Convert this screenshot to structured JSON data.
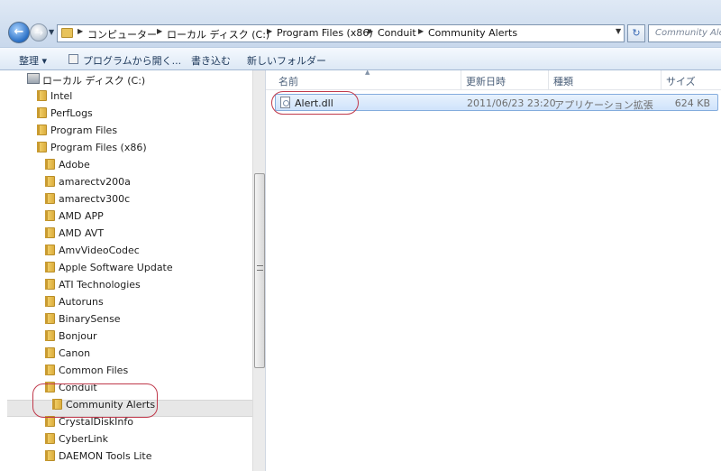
{
  "address_bar": {
    "crumbs": [
      "コンピューター",
      "ローカル ディスク (C:)",
      "Program Files (x86)",
      "Conduit",
      "Community Alerts"
    ],
    "search_placeholder": "Community Alerts"
  },
  "command_bar": {
    "organize": "整理 ▾",
    "open_with": "プログラムから開く...",
    "burn": "書き込む",
    "new_folder": "新しいフォルダー"
  },
  "nav_tree": {
    "drive": "ローカル ディスク (C:)",
    "items": [
      "Intel",
      "PerfLogs",
      "Program Files",
      "Program Files (x86)",
      "Adobe",
      "amarectv200a",
      "amarectv300c",
      "AMD APP",
      "AMD AVT",
      "AmvVideoCodec",
      "Apple Software Update",
      "ATI Technologies",
      "Autoruns",
      "BinarySense",
      "Bonjour",
      "Canon",
      "Common Files",
      "Conduit",
      "Community Alerts",
      "CrystalDiskInfo",
      "CyberLink",
      "DAEMON Tools Lite"
    ]
  },
  "columns": {
    "name": "名前",
    "modified": "更新日時",
    "type": "種類",
    "size": "サイズ"
  },
  "files": [
    {
      "name": "Alert.dll",
      "modified": "2011/06/23 23:20",
      "type": "アプリケーション拡張",
      "size": "624 KB"
    }
  ],
  "colors": {
    "annotation": "#c0394b",
    "selection": "#cfe3fb"
  }
}
